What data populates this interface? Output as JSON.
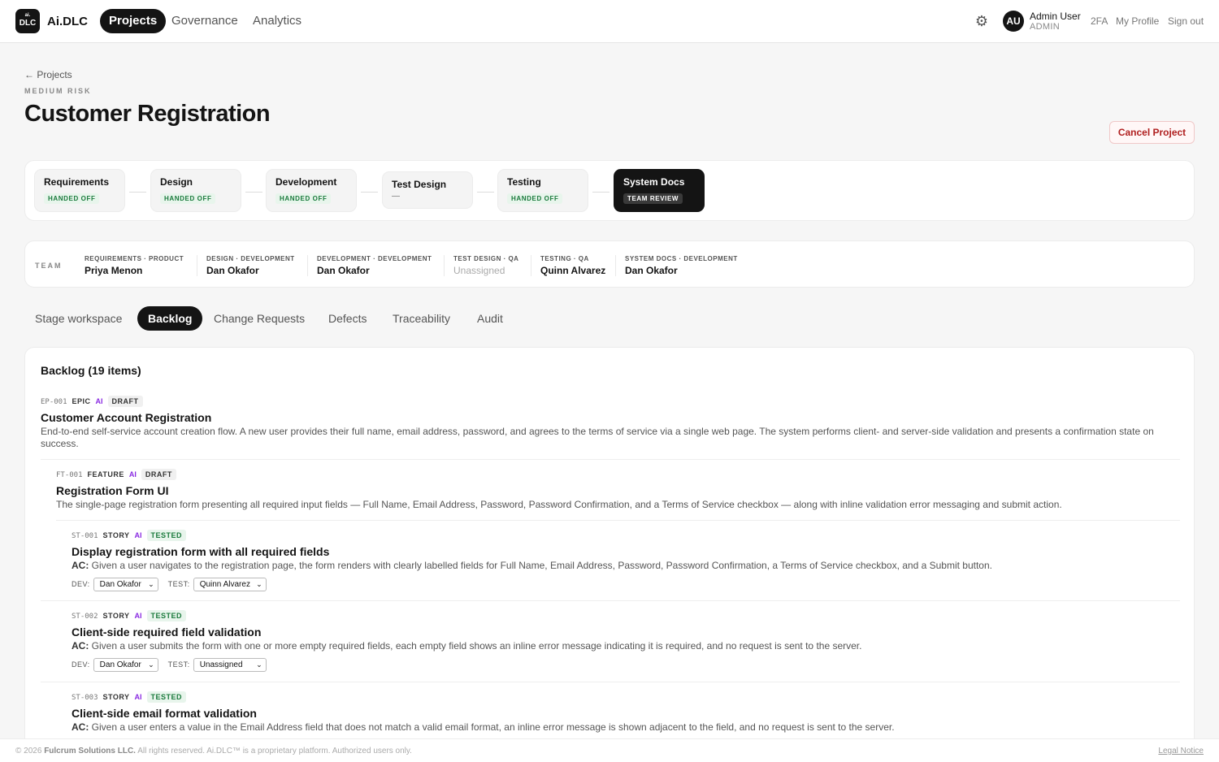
{
  "header": {
    "logo_small": "ai.",
    "logo_big": "DLC",
    "brand": "Ai.DLC",
    "nav": [
      "Projects",
      "Governance",
      "Analytics"
    ],
    "avatar_initials": "AU",
    "user_name": "Admin User",
    "user_role": "ADMIN",
    "links": [
      "2FA",
      "My Profile",
      "Sign out"
    ]
  },
  "page": {
    "back": "← Projects",
    "risk": "MEDIUM RISK",
    "title": "Customer Registration",
    "cancel": "Cancel Project"
  },
  "stages": [
    {
      "name": "Requirements",
      "status": "HANDED OFF"
    },
    {
      "name": "Design",
      "status": "HANDED OFF"
    },
    {
      "name": "Development",
      "status": "HANDED OFF"
    },
    {
      "name": "Test Design",
      "status": "—"
    },
    {
      "name": "Testing",
      "status": "HANDED OFF"
    },
    {
      "name": "System Docs",
      "status": "TEAM REVIEW"
    }
  ],
  "team": {
    "label": "TEAM",
    "members": [
      {
        "role": "REQUIREMENTS · PRODUCT",
        "name": "Priya Menon"
      },
      {
        "role": "DESIGN · DEVELOPMENT",
        "name": "Dan Okafor"
      },
      {
        "role": "DEVELOPMENT · DEVELOPMENT",
        "name": "Dan Okafor"
      },
      {
        "role": "TEST DESIGN · QA",
        "name": "Unassigned"
      },
      {
        "role": "TESTING · QA",
        "name": "Quinn Alvarez"
      },
      {
        "role": "SYSTEM DOCS · DEVELOPMENT",
        "name": "Dan Okafor"
      }
    ]
  },
  "tabs": [
    "Stage workspace",
    "Backlog",
    "Change Requests",
    "Defects",
    "Traceability",
    "Audit"
  ],
  "backlog": {
    "title": "Backlog (19 items)",
    "items": [
      {
        "id": "EP-001",
        "kind": "EPIC",
        "ai": "AI",
        "status": "DRAFT",
        "title": "Customer Account Registration",
        "desc": "End-to-end self-service account creation flow. A new user provides their full name, email address, password, and agrees to the terms of service via a single web page. The system performs client- and server-side validation and presents a confirmation state on success."
      },
      {
        "id": "FT-001",
        "kind": "FEATURE",
        "ai": "AI",
        "status": "DRAFT",
        "title": "Registration Form UI",
        "desc": "The single-page registration form presenting all required input fields — Full Name, Email Address, Password, Password Confirmation, and a Terms of Service checkbox — along with inline validation error messaging and submit action."
      },
      {
        "id": "ST-001",
        "kind": "STORY",
        "ai": "AI",
        "status": "TESTED",
        "title": "Display registration form with all required fields",
        "ac_label": "AC:",
        "desc": "Given a user navigates to the registration page, the form renders with clearly labelled fields for Full Name, Email Address, Password, Password Confirmation, a Terms of Service checkbox, and a Submit button.",
        "dev_label": "DEV:",
        "dev": "Dan Okafor",
        "test_label": "TEST:",
        "test": "Quinn Alvarez"
      },
      {
        "id": "ST-002",
        "kind": "STORY",
        "ai": "AI",
        "status": "TESTED",
        "title": "Client-side required field validation",
        "ac_label": "AC:",
        "desc": "Given a user submits the form with one or more empty required fields, each empty field shows an inline error message indicating it is required, and no request is sent to the server.",
        "dev_label": "DEV:",
        "dev": "Dan Okafor",
        "test_label": "TEST:",
        "test": "Unassigned"
      },
      {
        "id": "ST-003",
        "kind": "STORY",
        "ai": "AI",
        "status": "TESTED",
        "title": "Client-side email format validation",
        "ac_label": "AC:",
        "desc": "Given a user enters a value in the Email Address field that does not match a valid email format, an inline error message is shown adjacent to the field, and no request is sent to the server."
      }
    ]
  },
  "footer": {
    "copy_prefix": "© 2026",
    "company": "Fulcrum Solutions LLC.",
    "copy_suffix": "All rights reserved. Ai.DLC™ is a proprietary platform. Authorized users only.",
    "legal": "Legal Notice"
  },
  "colors": {
    "accent": "#141414",
    "success": "#1a7a3c",
    "danger": "#b02020",
    "ai": "#8a2be2"
  }
}
